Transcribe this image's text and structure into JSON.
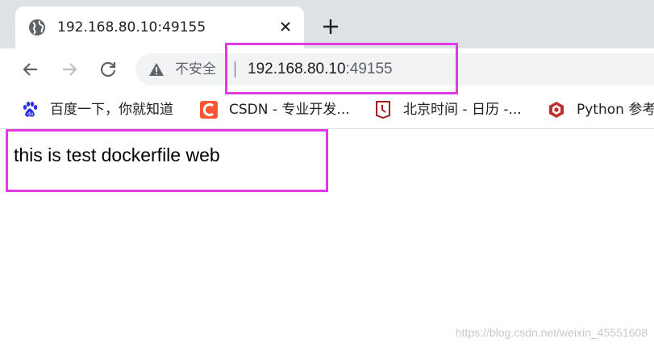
{
  "tab": {
    "title": "192.168.80.10:49155"
  },
  "omnibox": {
    "security_label": "不安全",
    "url_host": "192.168.80.10",
    "url_port": ":49155"
  },
  "bookmarks": [
    {
      "label": "百度一下，你就知道",
      "icon": "baidu-paw-icon"
    },
    {
      "label": "CSDN - 专业开发...",
      "icon": "csdn-c-icon"
    },
    {
      "label": "北京时间 - 日历 -...",
      "icon": "clock-flag-icon"
    },
    {
      "label": "Python 参考",
      "icon": "python-hex-icon"
    }
  ],
  "page": {
    "text": "this is test dockerfile web"
  },
  "watermark": "https://blog.csdn.net/weixin_45551608",
  "colors": {
    "highlight": "#e23be6",
    "tabstrip": "#dee1e6",
    "omnibox": "#f1f3f4",
    "csdn": "#fc5531",
    "clock": "#a41d24",
    "python": "#c22f2f",
    "baidu": "#2932e1"
  }
}
